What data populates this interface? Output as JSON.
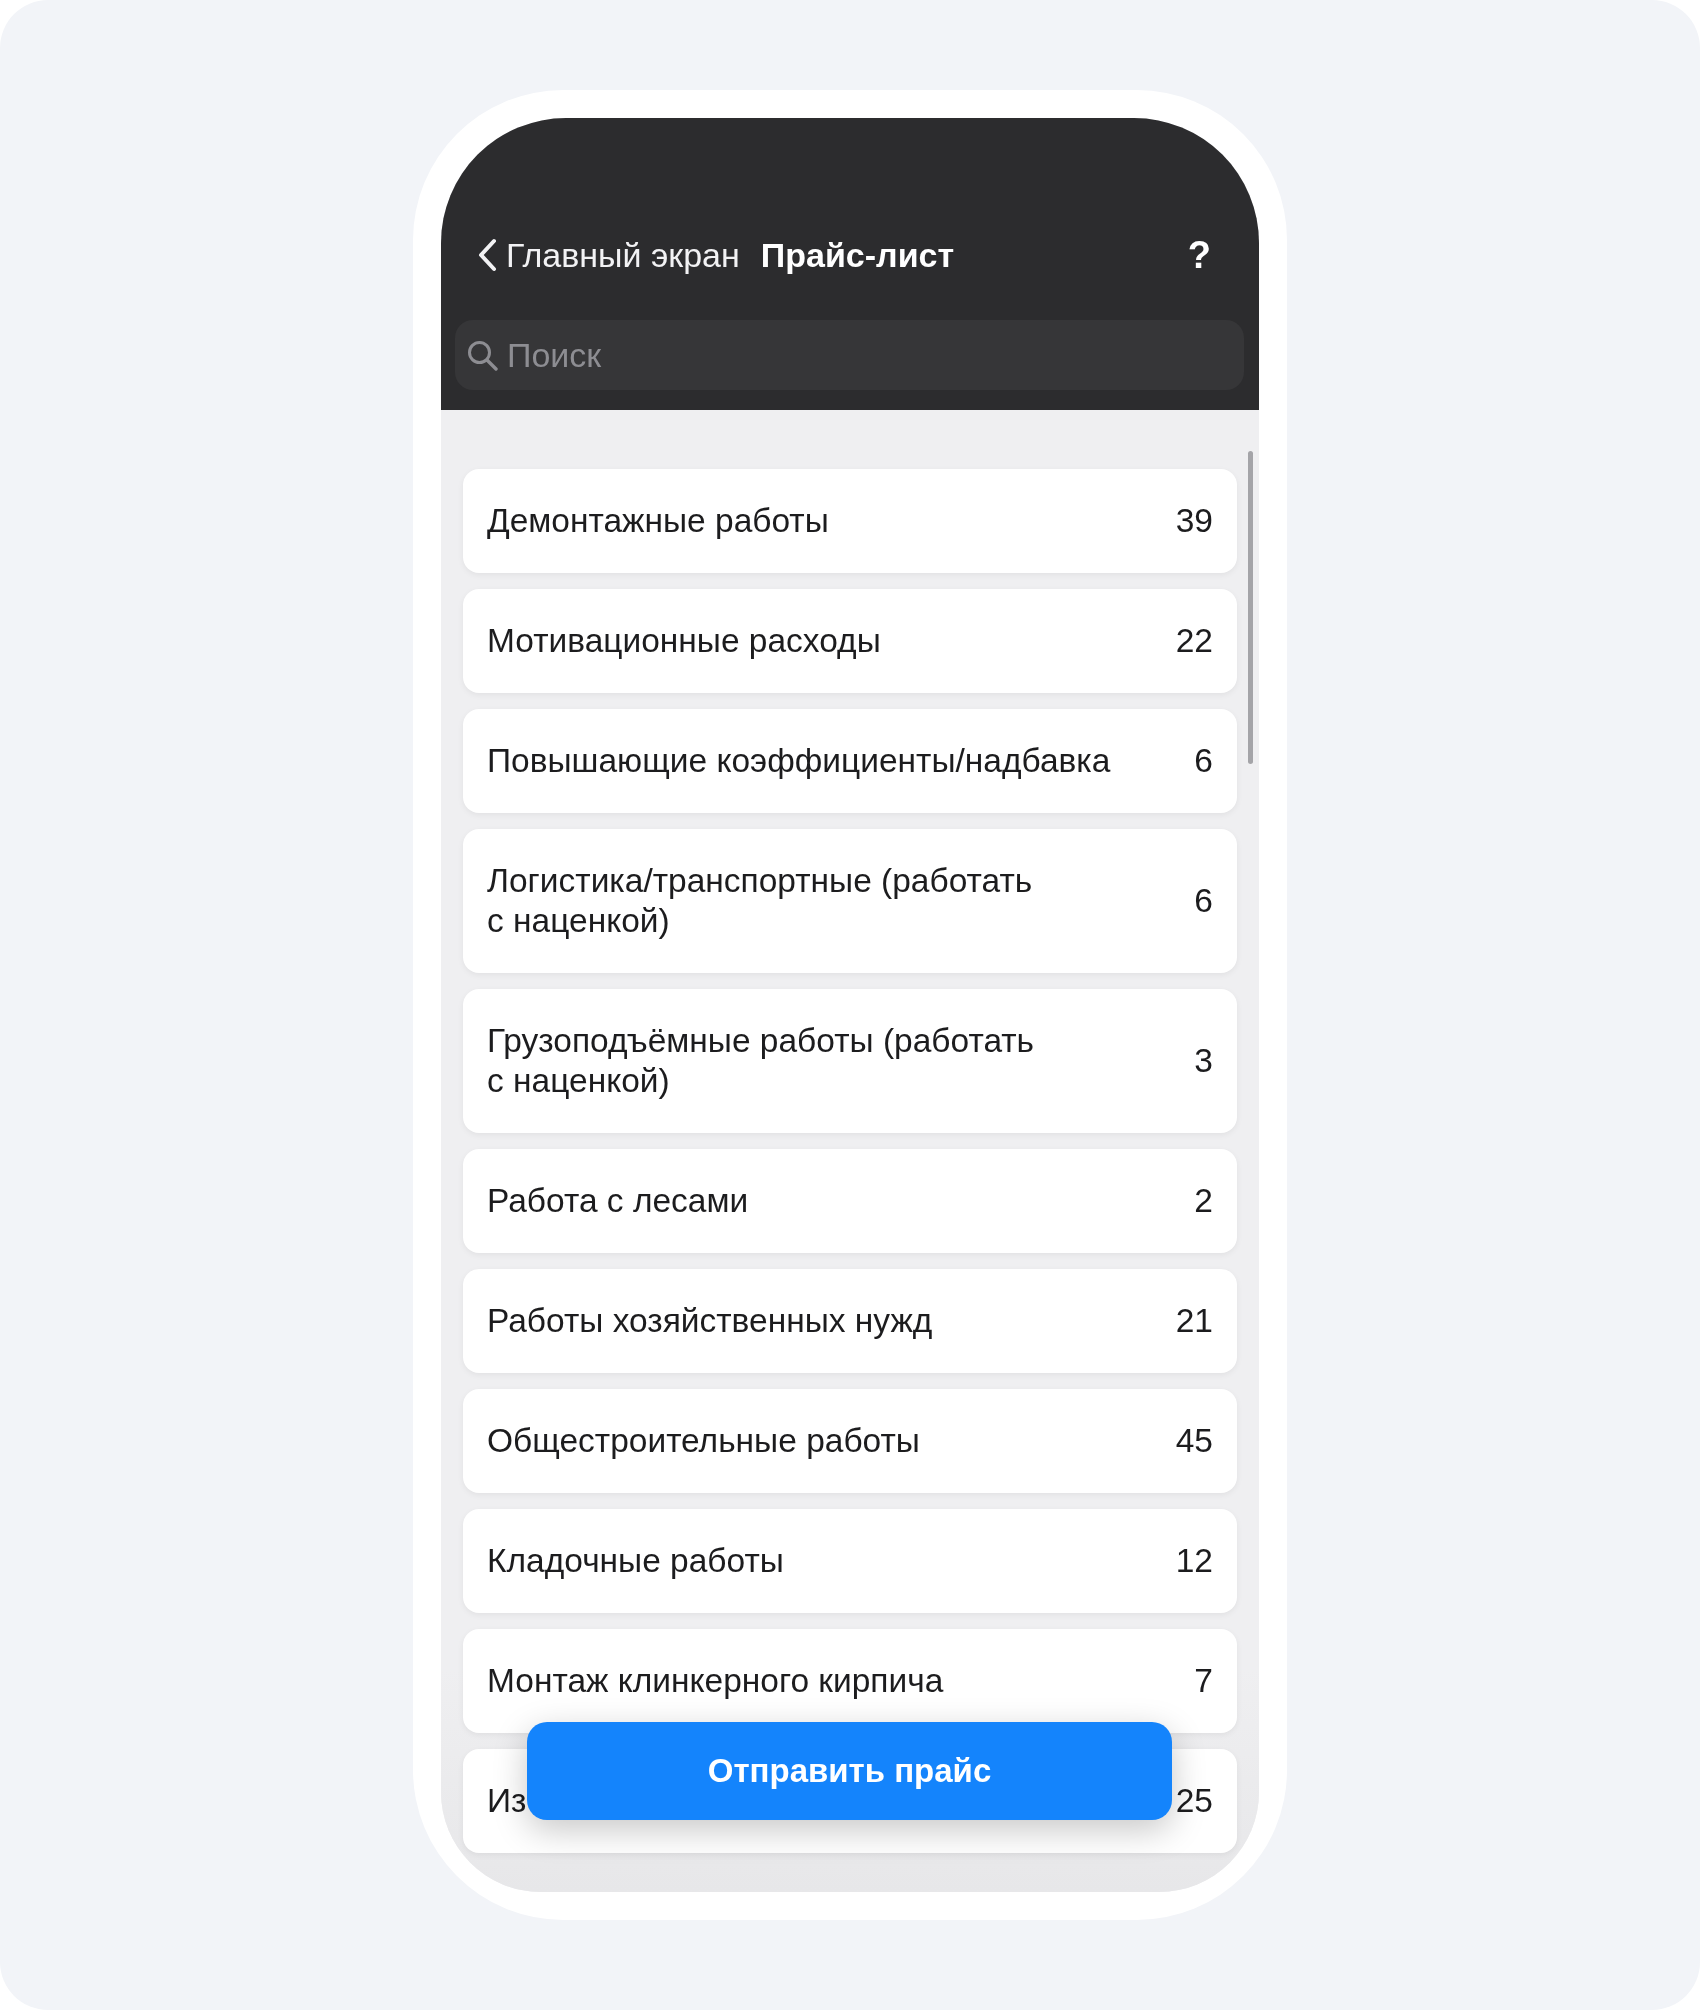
{
  "header": {
    "back_label": "Главный экран",
    "title": "Прайс-лист",
    "help": "?"
  },
  "search": {
    "placeholder": "Поиск"
  },
  "categories": [
    {
      "name": "Демонтажные работы",
      "count": "39"
    },
    {
      "name": "Мотивационные расходы",
      "count": "22"
    },
    {
      "name": "Повышающие коэффициенты/надбавка",
      "count": "6"
    },
    {
      "name": "Логистика/транспортные (работать с наценкой)",
      "count": "6"
    },
    {
      "name": "Грузоподъёмные работы (работать с наценкой)",
      "count": "3"
    },
    {
      "name": "Работа с лесами",
      "count": "2"
    },
    {
      "name": "Работы хозяйственных нужд",
      "count": "21"
    },
    {
      "name": "Общестроительные работы",
      "count": "45"
    },
    {
      "name": "Кладочные работы",
      "count": "12"
    },
    {
      "name": "Монтаж клинкерного кирпича",
      "count": "7"
    },
    {
      "name": "Из",
      "count": "25"
    }
  ],
  "send_button": {
    "label": "Отправить прайс"
  }
}
